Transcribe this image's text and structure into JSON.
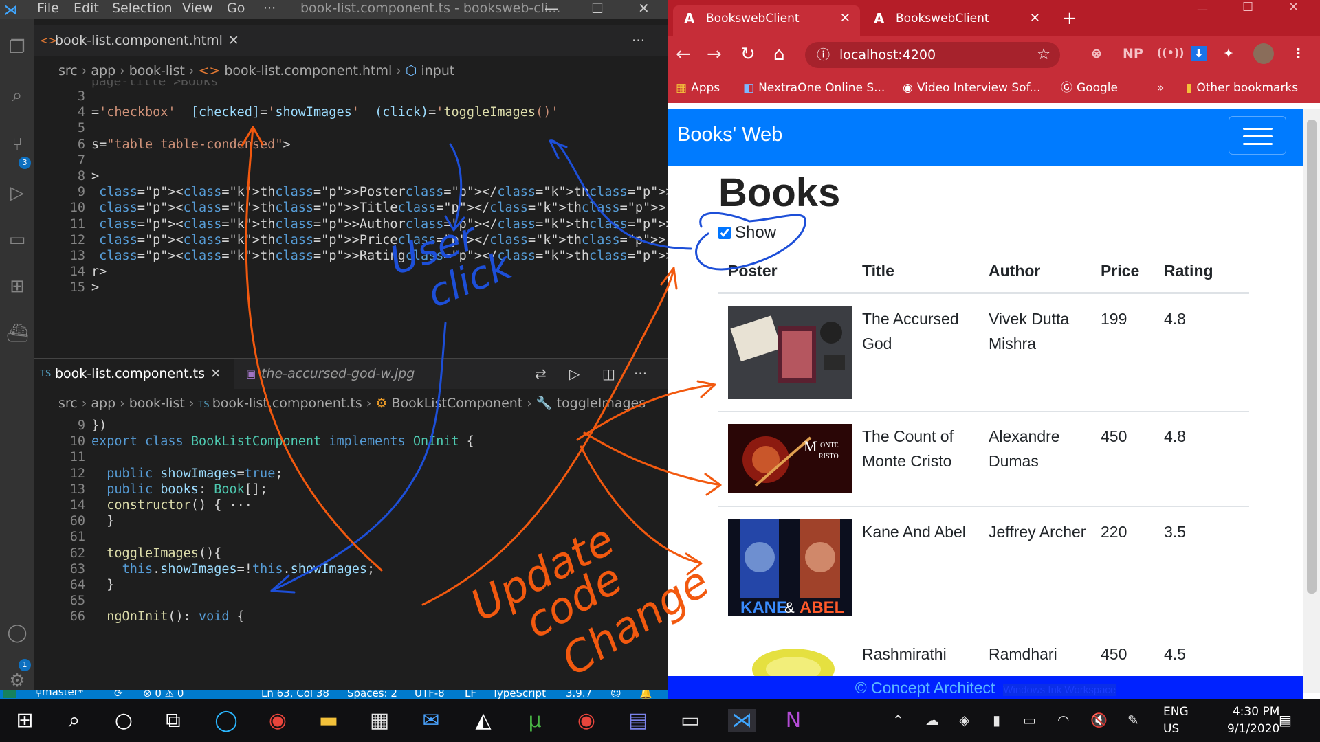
{
  "vscode": {
    "menu": [
      "File",
      "Edit",
      "Selection",
      "View",
      "Go",
      "···"
    ],
    "window_title": "book-list.component.ts - booksweb-cli...",
    "top_tab": {
      "icon": "<>",
      "label": "book-list.component.html"
    },
    "top_breadcrumb": [
      "src",
      "app",
      "book-list",
      "book-list.component.html",
      "input"
    ],
    "top_lines": [
      {
        "n": "3",
        "text": ""
      },
      {
        "n": "4",
        "text": "='checkbox'  [checked]='showImages'  (click)='toggleImages()'"
      },
      {
        "n": "5",
        "text": ""
      },
      {
        "n": "6",
        "text": "s=\"table table-condensed\">"
      },
      {
        "n": "7",
        "text": ""
      },
      {
        "n": "8",
        "text": ">"
      },
      {
        "n": "9",
        "text": " <th>Poster</th>"
      },
      {
        "n": "10",
        "text": " <th>Title</th>"
      },
      {
        "n": "11",
        "text": " <th>Author</th>"
      },
      {
        "n": "12",
        "text": " <th>Price</th>"
      },
      {
        "n": "13",
        "text": " <th>Rating</th>"
      },
      {
        "n": "14",
        "text": "r>"
      },
      {
        "n": "15",
        "text": ">"
      }
    ],
    "bottom_tabs": [
      {
        "icon": "TS",
        "label": "book-list.component.ts",
        "active": true
      },
      {
        "icon": "img",
        "label": "the-accursed-god-w.jpg",
        "active": false
      }
    ],
    "bottom_breadcrumb": [
      "src",
      "app",
      "book-list",
      "book-list.component.ts",
      "BookListComponent",
      "toggleImages"
    ],
    "bottom_lines": [
      {
        "n": "9",
        "text": "})"
      },
      {
        "n": "10",
        "text": "export class BookListComponent implements OnInit {"
      },
      {
        "n": "11",
        "text": ""
      },
      {
        "n": "12",
        "text": "  public showImages=true;"
      },
      {
        "n": "13",
        "text": "  public books: Book[];"
      },
      {
        "n": "14",
        "text": "  constructor() { ···"
      },
      {
        "n": "60",
        "text": "  }"
      },
      {
        "n": "61",
        "text": ""
      },
      {
        "n": "62",
        "text": "  toggleImages(){"
      },
      {
        "n": "63",
        "text": "    this.showImages=!this.showImages;"
      },
      {
        "n": "64",
        "text": "  }"
      },
      {
        "n": "65",
        "text": ""
      },
      {
        "n": "66",
        "text": "  ngOnInit(): void {"
      }
    ],
    "activity_badges": {
      "source_control": "3",
      "settings": "1"
    },
    "status_bar": {
      "branch": "master*",
      "problems": "⊗ 0 ⚠ 0",
      "position": "Ln 63, Col 38",
      "spaces": "Spaces: 2",
      "encoding": "UTF-8",
      "eol": "LF",
      "language": "TypeScript",
      "version": "3.9.7"
    }
  },
  "chrome": {
    "tabs": [
      {
        "title": "BookswebClient",
        "active": true
      },
      {
        "title": "BookswebClient",
        "active": false
      }
    ],
    "new_tab": "+",
    "url": "localhost:4200",
    "extensions": [
      "NP"
    ],
    "bookmarks": [
      "Apps",
      "NextraOne Online S...",
      "Video Interview Sof...",
      "Google",
      "»",
      "Other bookmarks"
    ],
    "accent_color": "#c62d38"
  },
  "app": {
    "brand": "Books' Web",
    "heading": "Books",
    "show_label": "Show",
    "show_checked": true,
    "columns": [
      "Poster",
      "Title",
      "Author",
      "Price",
      "Rating"
    ],
    "books": [
      {
        "title": "The Accursed God",
        "author": "Vivek Dutta Mishra",
        "price": "199",
        "rating": "4.8"
      },
      {
        "title": "The Count of Monte Cristo",
        "author": "Alexandre Dumas",
        "price": "450",
        "rating": "4.8"
      },
      {
        "title": "Kane And Abel",
        "author": "Jeffrey Archer",
        "price": "220",
        "rating": "3.5"
      },
      {
        "title": "Rashmirathi",
        "author": "Ramdhari",
        "price": "450",
        "rating": "4.5"
      }
    ],
    "footer": "© Concept Architect",
    "footer_watermark": "Windows Ink Workspace",
    "navbar_color": "#007bff"
  },
  "annotations": {
    "user_click": [
      "User",
      "click"
    ],
    "update_code_change": [
      "Update",
      "code",
      "Change"
    ],
    "colors": {
      "blue": "#1d4fd8",
      "orange": "#f2590f"
    }
  },
  "taskbar": {
    "lang": [
      "ENG",
      "US"
    ],
    "time": "4:30 PM",
    "date": "9/1/2020"
  }
}
